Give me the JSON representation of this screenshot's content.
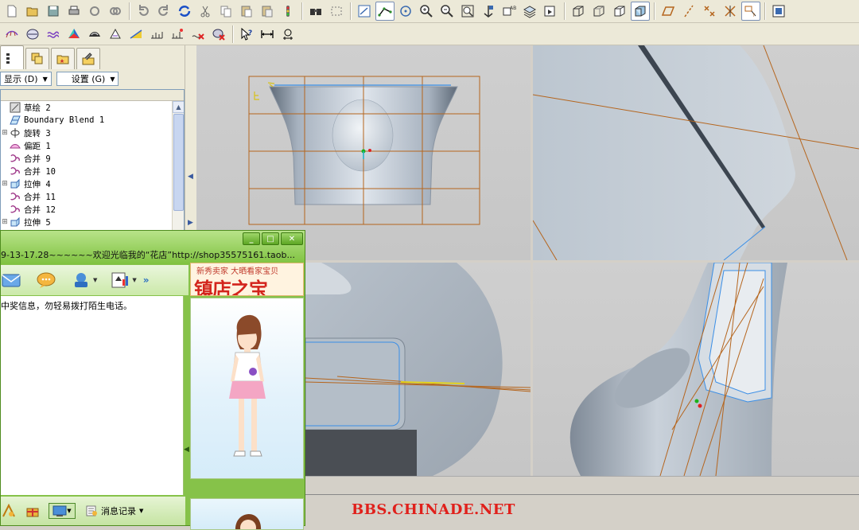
{
  "toolbar": {
    "row1_icons": [
      "new-icon",
      "open-icon",
      "save-icon",
      "print-icon",
      "view-icon",
      "link-icon",
      "undo-icon",
      "redo-icon",
      "regenerate-icon",
      "cut-icon",
      "copy-icon",
      "paste-icon",
      "paste-special-icon",
      "model-player-icon",
      "binoculars-icon",
      "select-box-icon",
      "sketch-icon",
      "spline-icon",
      "datum-icon",
      "zoom-in-icon",
      "zoom-out-icon",
      "zoom-fit-icon",
      "spin-icon",
      "named-view-icon",
      "layers-icon",
      "saved-views-icon",
      "wireframe-icon",
      "hidden-line-icon",
      "no-hidden-icon",
      "shading-icon",
      "datum-plane-icon",
      "datum-axis-icon",
      "datum-point-icon",
      "datum-csys-icon",
      "annotation-icon",
      "window-icon"
    ],
    "row2_icons": [
      "analysis-curvature-icon",
      "analysis-section-icon",
      "analysis-offset-icon",
      "analysis-shading-icon",
      "analysis-reflection-icon",
      "analysis-draft-icon",
      "analysis-slope-icon",
      "analysis-dihedral-icon",
      "analysis-deviation-icon",
      "delete-analysis-icon",
      "hide-analysis-icon",
      "whats-this-icon",
      "measure-distance-icon",
      "measure-angle-icon"
    ]
  },
  "panel": {
    "show_menu": "显示 (D)",
    "settings_menu": "设置 (G)"
  },
  "tree": {
    "items": [
      {
        "label": "草绘 2",
        "icon": "sketch-icon",
        "expandable": false
      },
      {
        "label": "Boundary Blend 1",
        "icon": "boundary-blend-icon",
        "expandable": false
      },
      {
        "label": "旋转 3",
        "icon": "revolve-icon",
        "expandable": true
      },
      {
        "label": "偏距 1",
        "icon": "offset-icon",
        "expandable": false
      },
      {
        "label": "合并 9",
        "icon": "merge-icon",
        "expandable": false
      },
      {
        "label": "合并 10",
        "icon": "merge-icon",
        "expandable": false
      },
      {
        "label": "拉伸 4",
        "icon": "extrude-icon",
        "expandable": true
      },
      {
        "label": "合并 11",
        "icon": "merge-icon",
        "expandable": false
      },
      {
        "label": "合并 12",
        "icon": "merge-icon",
        "expandable": false
      },
      {
        "label": "拉伸 5",
        "icon": "extrude-icon",
        "expandable": true
      }
    ]
  },
  "chat": {
    "subject": "9-13-17.28~~~~~~欢迎光临我的“花店”http://shop35575161.taob...",
    "message": "中奖信息，勿轻易拨打陌生电话。",
    "ad_sub": "新秀卖家 大晒看家宝贝",
    "ad_title": "镇店之宝",
    "message_record": "消息记录",
    "more": "»"
  },
  "watermark": "BBS.CHINADE.NET",
  "colors": {
    "toolbar_bg": "#ece9d8",
    "viewport_bg": "#c8c8c8",
    "chat_green": "#86c249",
    "datum_orange": "#b5651d",
    "edge_blue": "#3a8ee6",
    "watermark_red": "#e0201b"
  }
}
